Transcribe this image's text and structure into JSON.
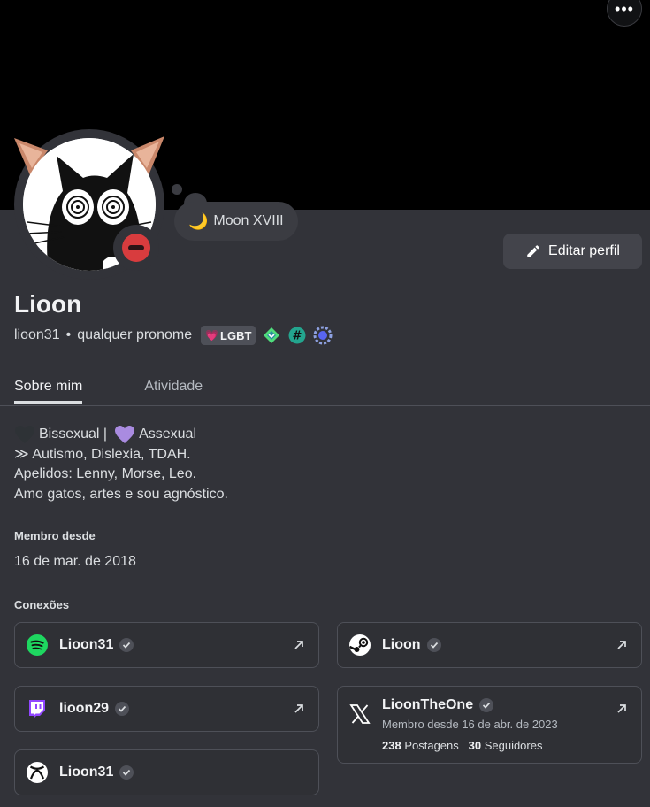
{
  "profile": {
    "display_name": "Lioon",
    "username": "lioon31",
    "pronouns": "qualquer pronome",
    "tag": "LGBT",
    "custom_status": "Moon XVIII",
    "edit_button": "Editar perfil"
  },
  "tabs": [
    {
      "label": "Sobre mim",
      "active": true
    },
    {
      "label": "Atividade",
      "active": false
    }
  ],
  "bio": {
    "line1_a": "Bissexual |",
    "line1_b": "Assexual",
    "line2": "≫ Autismo, Dislexia, TDAH.",
    "line3": "Apelidos: Lenny, Morse, Leo.",
    "line4": "Amo gatos, artes e sou agnóstico."
  },
  "member_since": {
    "label": "Membro desde",
    "date": "16 de mar. de 2018"
  },
  "connections": {
    "label": "Conexões",
    "items": [
      {
        "service": "spotify",
        "name": "Lioon31"
      },
      {
        "service": "steam",
        "name": "Lioon"
      },
      {
        "service": "twitch",
        "name": "lioon29"
      },
      {
        "service": "x",
        "name": "LioonTheOne",
        "subtitle": "Membro desde 16 de abr. de 2023",
        "posts_count": "238",
        "posts_label": "Postagens",
        "followers_count": "30",
        "followers_label": "Seguidores"
      },
      {
        "service": "xbox",
        "name": "Lioon31"
      }
    ]
  },
  "colors": {
    "background": "#323339",
    "banner": "#000000",
    "dnd_status": "#d83c3e",
    "spotify": "#1ed760",
    "twitch": "#9146ff"
  },
  "icons": [
    "more-icon",
    "pencil-icon",
    "moon-icon",
    "do-not-disturb-icon",
    "heart-icon",
    "nitro-badge-icon",
    "hashtag-badge-icon",
    "quest-badge-icon",
    "spotify-icon",
    "steam-icon",
    "twitch-icon",
    "x-icon",
    "xbox-icon",
    "verified-icon",
    "external-link-icon"
  ]
}
